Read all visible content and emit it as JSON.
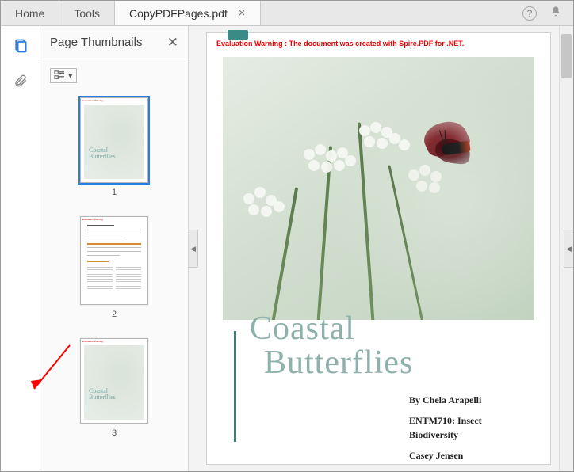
{
  "tabs": {
    "home": "Home",
    "tools": "Tools",
    "file": "CopyPDFPages.pdf"
  },
  "panel": {
    "title": "Page Thumbnails"
  },
  "thumbnails": [
    {
      "label": "1"
    },
    {
      "label": "2"
    },
    {
      "label": "3"
    }
  ],
  "page": {
    "warning": "Evaluation Warning : The document was created with Spire.PDF for .NET.",
    "title_line1": "Coastal",
    "title_line2": "Butterflies",
    "byline": "By Chela Arapelli",
    "course": "ENTM710: Insect Biodiversity",
    "instructor": "Casey Jensen"
  },
  "icons": {
    "help": "?",
    "bell": "bell",
    "thumbnails": "pages",
    "attachments": "paperclip",
    "options": "list-dropdown"
  }
}
